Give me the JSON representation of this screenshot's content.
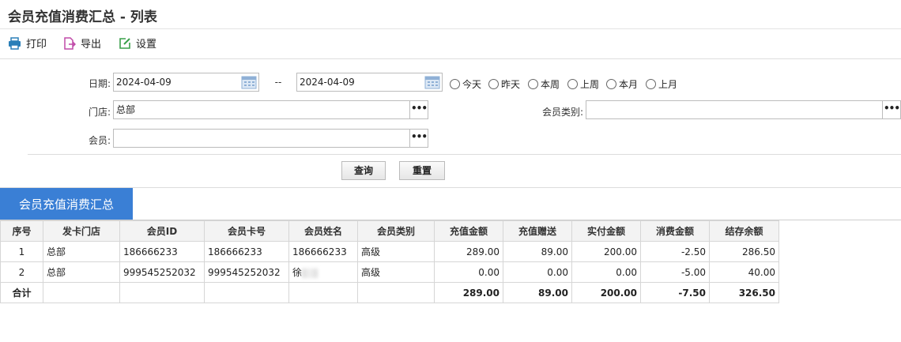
{
  "page_title": "会员充值消费汇总 - 列表",
  "toolbar": {
    "print": "打印",
    "export": "导出",
    "settings": "设置"
  },
  "filters": {
    "date_label": "日期:",
    "date_from": "2024-04-09",
    "date_sep": "--",
    "date_to": "2024-04-09",
    "quick_dates": [
      "今天",
      "昨天",
      "本周",
      "上周",
      "本月",
      "上月"
    ],
    "store_label": "门店:",
    "store_value": "总部",
    "member_type_label": "会员类别:",
    "member_type_value": "",
    "member_label": "会员:",
    "member_value": "",
    "more_glyph": "•••"
  },
  "buttons": {
    "query": "查询",
    "reset": "重置"
  },
  "tab_title": "会员充值消费汇总",
  "table": {
    "headers": [
      "序号",
      "发卡门店",
      "会员ID",
      "会员卡号",
      "会员姓名",
      "会员类别",
      "充值金额",
      "充值赠送",
      "实付金额",
      "消费金额",
      "结存余额"
    ],
    "rows": [
      [
        "1",
        "总部",
        "186666233",
        "186666233",
        "186666233",
        "高级",
        "289.00",
        "89.00",
        "200.00",
        "-2.50",
        "286.50"
      ],
      [
        "2",
        "总部",
        "999545252032",
        "999545252032",
        "徐",
        "高级",
        "0.00",
        "0.00",
        "0.00",
        "-5.00",
        "40.00"
      ]
    ],
    "total": [
      "合计",
      "",
      "",
      "",
      "",
      "",
      "289.00",
      "89.00",
      "200.00",
      "-7.50",
      "326.50"
    ]
  },
  "colors": {
    "accent": "#3a7fd5",
    "print_icon": "#2a7fb8",
    "export_icon": "#c04aa8",
    "settings_icon": "#3aa04a"
  },
  "icons": {
    "print": "printer-icon",
    "export": "export-icon",
    "settings": "edit-settings-icon",
    "calendar": "calendar-icon"
  }
}
